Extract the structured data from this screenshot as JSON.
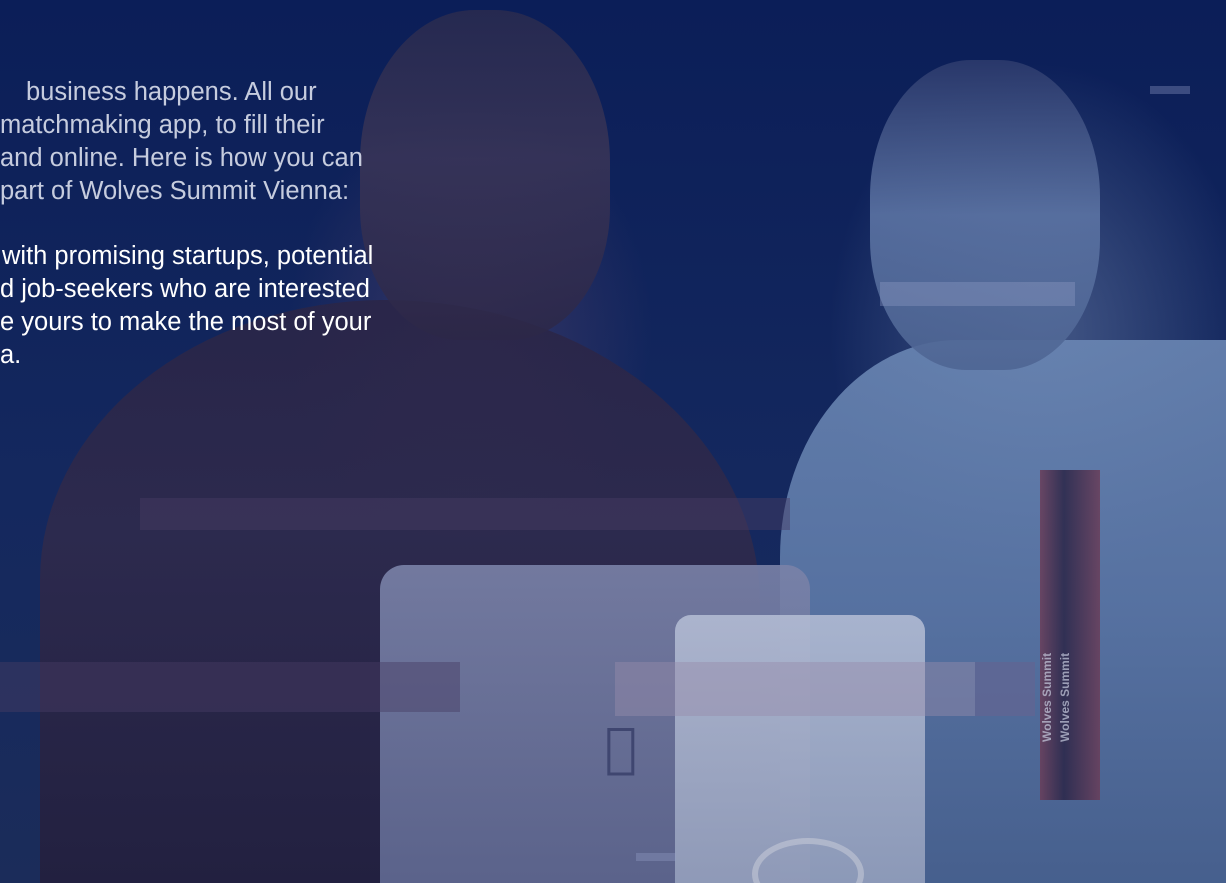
{
  "intro": {
    "lines": [
      "business happens. All our",
      "matchmaking app, to fill their",
      "and online. Here is how you can",
      "part of Wolves Summit Vienna:"
    ]
  },
  "benefit": {
    "lines": [
      "with promising startups, potential",
      "d job-seekers who are interested",
      "e yours to make the most of your",
      "a."
    ]
  },
  "photo": {
    "lanyard_text_1": "Wolves Summit",
    "lanyard_text_2": "Wolves Summit",
    "laptop_logo_icon": "apple-logo-icon"
  }
}
